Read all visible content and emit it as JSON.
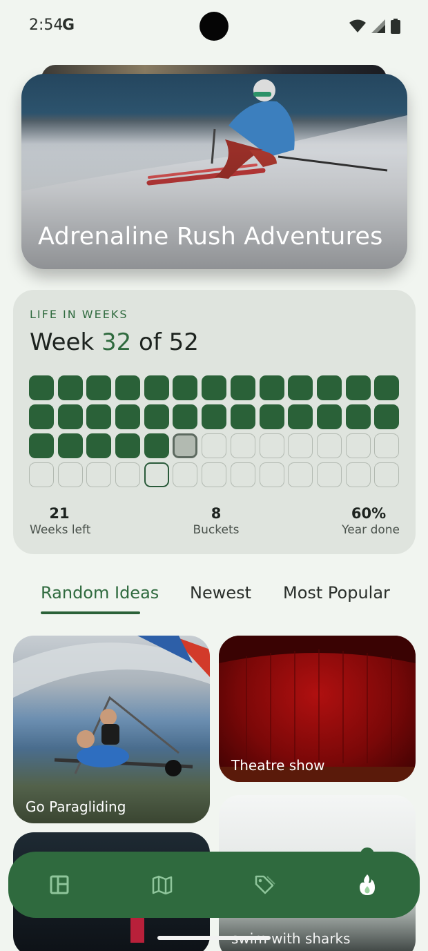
{
  "status_bar": {
    "time": "2:54",
    "google_letter": "G"
  },
  "hero": {
    "title": "Adrenaline Rush Adventures"
  },
  "life_in_weeks": {
    "label": "LIFE IN WEEKS",
    "prefix": "Week ",
    "current_week": "32",
    "suffix": " of 52",
    "weeks_completed": 31,
    "current_week_index": 32,
    "total_weeks": 52,
    "stats": [
      {
        "value": "21",
        "label": "Weeks left"
      },
      {
        "value": "8",
        "label": "Buckets"
      },
      {
        "value": "60%",
        "label": "Year done"
      }
    ]
  },
  "tabs": [
    {
      "label": "Random Ideas",
      "active": true
    },
    {
      "label": "Newest",
      "active": false
    },
    {
      "label": "Most Popular",
      "active": false
    }
  ],
  "ideas": [
    {
      "title": "Go Paragliding"
    },
    {
      "title": "Theatre show"
    },
    {
      "title": ""
    },
    {
      "title": "swim with sharks"
    }
  ],
  "bottom_nav": {
    "items": [
      "dashboard-icon",
      "map-icon",
      "tag-icon",
      "flame-icon"
    ],
    "active": "flame-icon",
    "accent": "#2f6a3e"
  }
}
